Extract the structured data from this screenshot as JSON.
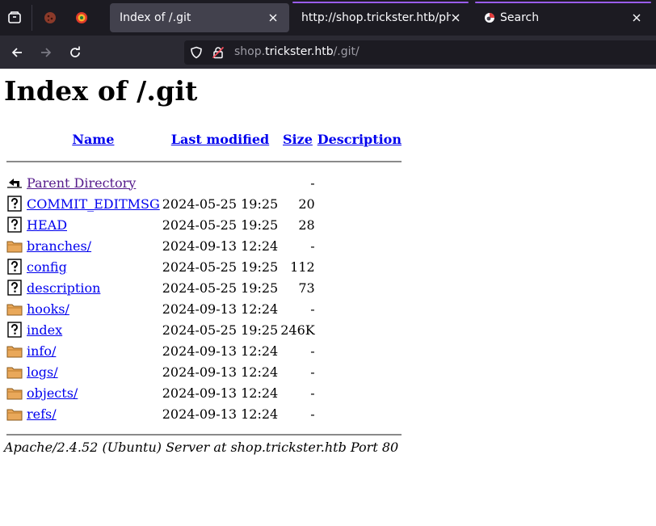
{
  "browser": {
    "tabs": [
      {
        "title": "Index of /.git",
        "active": true
      },
      {
        "title": "http://shop.trickster.htb/php",
        "active": false
      },
      {
        "title": "Search",
        "active": false
      }
    ],
    "url": {
      "prefix": "shop.",
      "host": "trickster.htb",
      "path": "/.git/"
    },
    "colors": {
      "tabbar": "#1c1b22",
      "navbar": "#2b2a33",
      "active_tab": "#42414d",
      "context_line": "#9a5cf0"
    }
  },
  "page": {
    "title": "Index of /.git",
    "columns": {
      "name": "Name",
      "last_modified": "Last modified",
      "size": "Size",
      "description": "Description"
    },
    "parent": {
      "label": "Parent Directory",
      "size": "-",
      "icon": "back-icon"
    },
    "rows": [
      {
        "name": "COMMIT_EDITMSG",
        "modified": "2024-05-25 19:25",
        "size": "20",
        "icon": "unknown-file-icon"
      },
      {
        "name": "HEAD",
        "modified": "2024-05-25 19:25",
        "size": "28",
        "icon": "unknown-file-icon"
      },
      {
        "name": "branches/",
        "modified": "2024-09-13 12:24",
        "size": "-",
        "icon": "folder-icon"
      },
      {
        "name": "config",
        "modified": "2024-05-25 19:25",
        "size": "112",
        "icon": "unknown-file-icon"
      },
      {
        "name": "description",
        "modified": "2024-05-25 19:25",
        "size": "73",
        "icon": "unknown-file-icon"
      },
      {
        "name": "hooks/",
        "modified": "2024-09-13 12:24",
        "size": "-",
        "icon": "folder-icon"
      },
      {
        "name": "index",
        "modified": "2024-05-25 19:25",
        "size": "246K",
        "icon": "unknown-file-icon"
      },
      {
        "name": "info/",
        "modified": "2024-09-13 12:24",
        "size": "-",
        "icon": "folder-icon"
      },
      {
        "name": "logs/",
        "modified": "2024-09-13 12:24",
        "size": "-",
        "icon": "folder-icon"
      },
      {
        "name": "objects/",
        "modified": "2024-09-13 12:24",
        "size": "-",
        "icon": "folder-icon"
      },
      {
        "name": "refs/",
        "modified": "2024-09-13 12:24",
        "size": "-",
        "icon": "folder-icon"
      }
    ],
    "footer": "Apache/2.4.52 (Ubuntu) Server at shop.trickster.htb Port 80"
  }
}
